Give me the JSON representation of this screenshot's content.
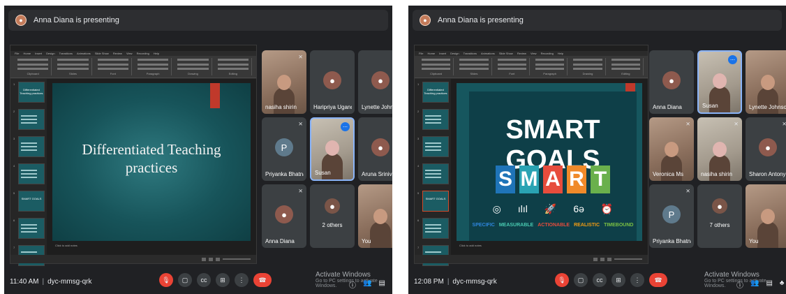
{
  "left": {
    "presenter_banner": "Anna Diana is presenting",
    "slide": {
      "title_line1": "Differentiated Teaching",
      "title_line2": "practices"
    },
    "thumbnails": [
      {
        "num": "1",
        "text": "Differentiated Teaching practices"
      },
      {
        "num": "2",
        "text": ""
      },
      {
        "num": "3",
        "text": ""
      },
      {
        "num": "4",
        "text": ""
      },
      {
        "num": "5",
        "text": "SMART GOALS"
      },
      {
        "num": "6",
        "text": ""
      },
      {
        "num": "7",
        "text": ""
      }
    ],
    "notes_placeholder": "Click to add notes",
    "participants": [
      {
        "name": "nasiha shirin",
        "type": "photo",
        "muted": true
      },
      {
        "name": "Haripriya Ugandhar",
        "type": "avatar",
        "muted": false
      },
      {
        "name": "Lynette Johnson",
        "type": "avatar",
        "muted": false
      },
      {
        "name": "Priyanka Bhatnagar",
        "type": "letter",
        "letter": "P",
        "muted": true
      },
      {
        "name": "Susan",
        "type": "photo2",
        "muted": false,
        "speaking": true
      },
      {
        "name": "Aruna Srinivasan",
        "type": "avatar",
        "muted": true
      },
      {
        "name": "Anna Diana",
        "type": "avatar",
        "muted": true
      },
      {
        "name": "2 others",
        "type": "group",
        "muted": false
      },
      {
        "name": "You",
        "type": "photo",
        "muted": true
      }
    ],
    "clock": "11:40 AM",
    "meeting_code": "dyc-mmsg-qrk"
  },
  "right": {
    "presenter_banner": "Anna Diana is presenting",
    "slide": {
      "title": "SMART GOALS",
      "letters": [
        {
          "char": "S",
          "color": "#1f74b8"
        },
        {
          "char": "M",
          "color": "#2aa3b3"
        },
        {
          "char": "A",
          "color": "#e74c3c"
        },
        {
          "char": "R",
          "color": "#f08a2a"
        },
        {
          "char": "T",
          "color": "#6ab04c"
        }
      ],
      "icons": [
        "◎",
        "ılıl",
        "🚀",
        "6ə",
        "⏰"
      ],
      "words": [
        {
          "text": "SPECIFIC",
          "color": "#2e86de"
        },
        {
          "text": "MEASURABLE",
          "color": "#48c9b0"
        },
        {
          "text": "ACTIONABLE",
          "color": "#e74c3c"
        },
        {
          "text": "REALISTIC",
          "color": "#f39c12"
        },
        {
          "text": "TIMEBOUND",
          "color": "#7bc043"
        }
      ]
    },
    "thumbnails": [
      {
        "num": "1",
        "text": "Differentiated Teaching practices"
      },
      {
        "num": "2",
        "text": ""
      },
      {
        "num": "3",
        "text": ""
      },
      {
        "num": "4",
        "text": ""
      },
      {
        "num": "5",
        "text": "SMART GOALS"
      },
      {
        "num": "6",
        "text": ""
      },
      {
        "num": "7",
        "text": ""
      }
    ],
    "notes_placeholder": "Click to add notes",
    "participants": [
      {
        "name": "Anna Diana",
        "type": "avatar",
        "muted": false
      },
      {
        "name": "Susan",
        "type": "photo2",
        "muted": false,
        "speaking": true
      },
      {
        "name": "Lynette Johnson",
        "type": "photo",
        "muted": false
      },
      {
        "name": "Veronica Ms",
        "type": "photo",
        "muted": true
      },
      {
        "name": "nasiha shirin",
        "type": "photo2",
        "muted": true
      },
      {
        "name": "Sharon Antony",
        "type": "avatar",
        "muted": true
      },
      {
        "name": "Priyanka Bhatnagar",
        "type": "letter",
        "letter": "P",
        "muted": true
      },
      {
        "name": "7 others",
        "type": "group",
        "muted": false
      },
      {
        "name": "You",
        "type": "photo",
        "muted": false
      }
    ],
    "clock": "12:08 PM",
    "meeting_code": "dyc-mmsg-qrk"
  },
  "activate": {
    "line1": "Activate Windows",
    "line2": "Go to PC settings to activate Windows."
  },
  "ppt_menu": [
    "File",
    "Home",
    "Insert",
    "Design",
    "Transitions",
    "Animations",
    "Slide Show",
    "Review",
    "View",
    "Recording",
    "Help"
  ],
  "ppt_ribbon_groups": [
    "Clipboard",
    "Slides",
    "Font",
    "Paragraph",
    "Drawing",
    "Editing"
  ]
}
